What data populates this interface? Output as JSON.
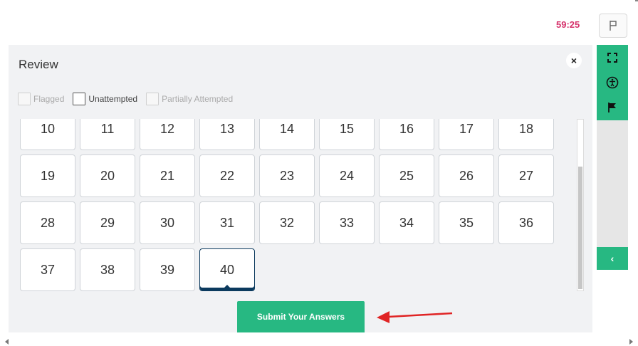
{
  "header": {
    "timer": "59:25",
    "flag_button_icon": "flag-outline-icon"
  },
  "review_panel": {
    "title": "Review",
    "close_label": "×",
    "legend": [
      {
        "label": "Flagged",
        "state": "inactive"
      },
      {
        "label": "Unattempted",
        "state": "active"
      },
      {
        "label": "Partially Attempted",
        "state": "inactive"
      }
    ],
    "questions": [
      "10",
      "11",
      "12",
      "13",
      "14",
      "15",
      "16",
      "17",
      "18",
      "19",
      "20",
      "21",
      "22",
      "23",
      "24",
      "25",
      "26",
      "27",
      "28",
      "29",
      "30",
      "31",
      "32",
      "33",
      "34",
      "35",
      "36",
      "37",
      "38",
      "39",
      "40"
    ],
    "current_question": "40",
    "submit_label": "Submit Your Answers"
  },
  "side_toolbar": {
    "icons": [
      "fullscreen-icon",
      "accessibility-icon",
      "flag-icon"
    ],
    "collapse_label": "‹"
  },
  "colors": {
    "accent_green": "#27b882",
    "timer_pink": "#d6336c",
    "current_border": "#0b3a5e",
    "annotation_arrow": "#e02424"
  }
}
